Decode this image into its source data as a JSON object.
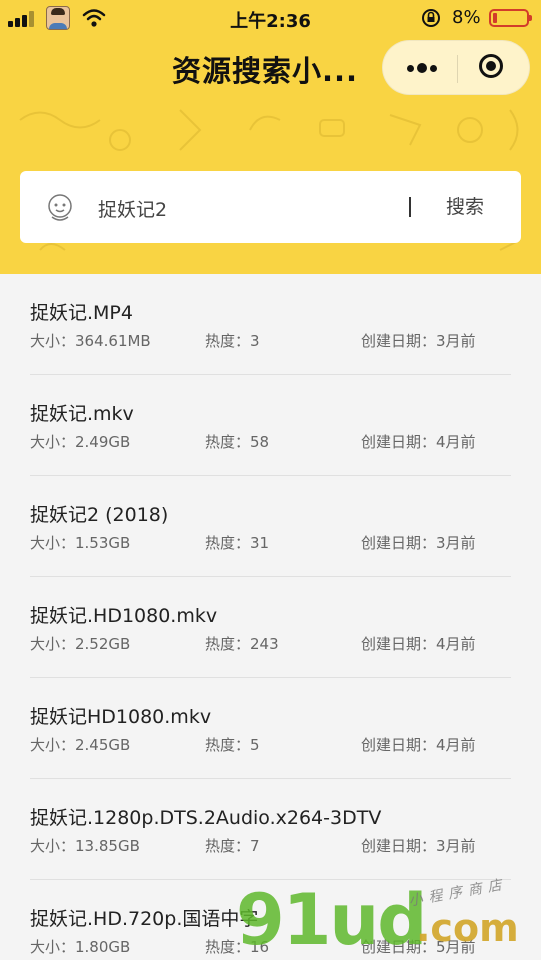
{
  "status_bar": {
    "time": "上午2:36",
    "battery_percent": "8%",
    "battery_level": 0.08,
    "icons": [
      "signal-icon",
      "avatar-icon",
      "wifi-icon",
      "rotation-lock-icon",
      "battery-icon"
    ]
  },
  "nav": {
    "title": "资源搜索小...",
    "more_icon": "more-dots-icon",
    "close_icon": "target-close-icon"
  },
  "search": {
    "value": "捉妖记2",
    "button_label": "搜索",
    "icon": "face-icon"
  },
  "results": [
    {
      "title": "捉妖记.MP4",
      "size": "大小：364.61MB",
      "heat": "热度：3",
      "date": "创建日期：3月前"
    },
    {
      "title": "捉妖记.mkv",
      "size": "大小：2.49GB",
      "heat": "热度：58",
      "date": "创建日期：4月前"
    },
    {
      "title": "捉妖记2 (2018)",
      "size": "大小：1.53GB",
      "heat": "热度：31",
      "date": "创建日期：3月前"
    },
    {
      "title": "捉妖记.HD1080.mkv",
      "size": "大小：2.52GB",
      "heat": "热度：243",
      "date": "创建日期：4月前"
    },
    {
      "title": "捉妖记HD1080.mkv",
      "size": "大小：2.45GB",
      "heat": "热度：5",
      "date": "创建日期：4月前"
    },
    {
      "title": "捉妖记.1280p.DTS.2Audio.x264-3DTV",
      "size": "大小：13.85GB",
      "heat": "热度：7",
      "date": "创建日期：3月前"
    },
    {
      "title": "捉妖记.HD.720p.国语中字",
      "size": "大小：1.80GB",
      "heat": "热度：16",
      "date": "创建日期：5月前"
    }
  ],
  "watermark": {
    "main": "91ud",
    "suffix": ".com",
    "sub": "小程序商店"
  },
  "colors": {
    "header_bg": "#f9d443",
    "list_bg": "#f4f4f4",
    "battery_low": "#d23c2a"
  }
}
